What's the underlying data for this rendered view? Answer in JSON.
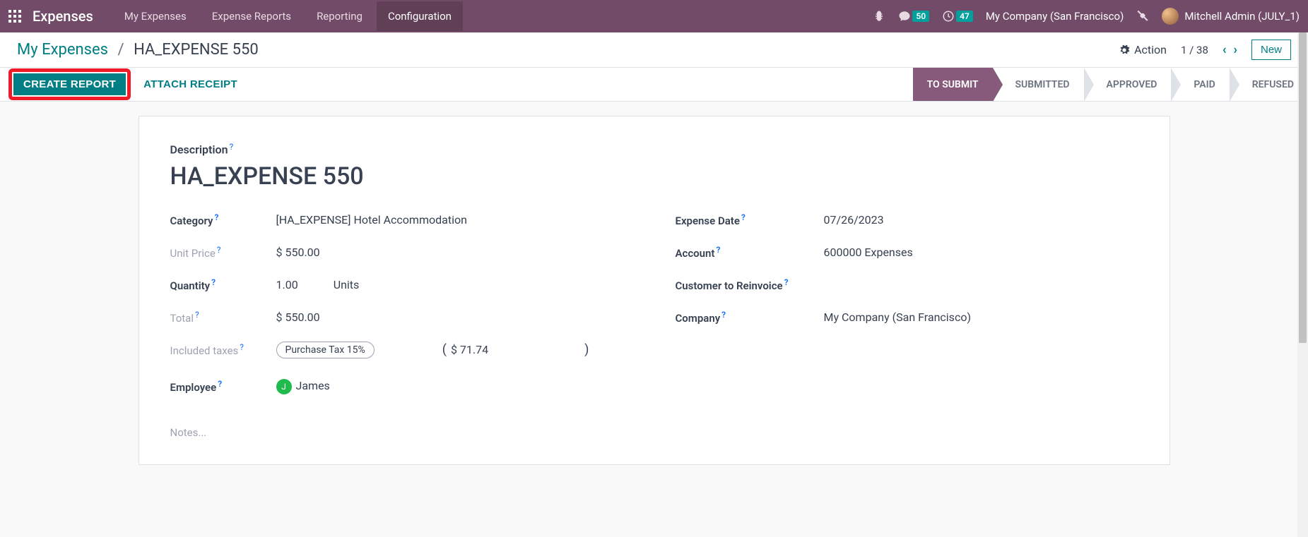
{
  "topnav": {
    "brand": "Expenses",
    "items": [
      "My Expenses",
      "Expense Reports",
      "Reporting",
      "Configuration"
    ],
    "active_index": 3,
    "chat_badge": "50",
    "activity_badge": "47",
    "company": "My Company (San Francisco)",
    "user": "Mitchell Admin (JULY_1)"
  },
  "breadcrumb": {
    "parent": "My Expenses",
    "current": "HA_EXPENSE 550",
    "action_label": "Action",
    "pager": "1 / 38",
    "new_label": "New"
  },
  "statusbar": {
    "create_report": "CREATE REPORT",
    "attach_receipt": "ATTACH RECEIPT",
    "steps": [
      "TO SUBMIT",
      "SUBMITTED",
      "APPROVED",
      "PAID",
      "REFUSED"
    ],
    "active_step": 0
  },
  "form": {
    "description_label": "Description",
    "title": "HA_EXPENSE 550",
    "left": {
      "category_label": "Category",
      "category_value": "[HA_EXPENSE] Hotel Accommodation",
      "unit_price_label": "Unit Price",
      "unit_price_value": "$ 550.00",
      "quantity_label": "Quantity",
      "quantity_value": "1.00",
      "quantity_unit": "Units",
      "total_label": "Total",
      "total_value": "$ 550.00",
      "taxes_label": "Included taxes",
      "taxes_tag": "Purchase Tax 15%",
      "taxes_amount": "$ 71.74",
      "employee_label": "Employee",
      "employee_initial": "J",
      "employee_value": "James"
    },
    "right": {
      "date_label": "Expense Date",
      "date_value": "07/26/2023",
      "account_label": "Account",
      "account_value": "600000 Expenses",
      "reinvoice_label": "Customer to Reinvoice",
      "company_label": "Company",
      "company_value": "My Company (San Francisco)"
    },
    "notes_placeholder": "Notes..."
  }
}
